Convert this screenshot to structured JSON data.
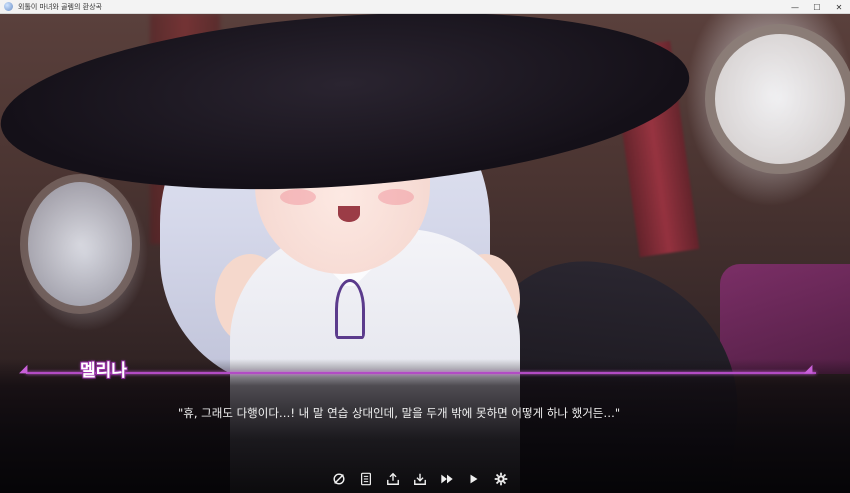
{
  "window": {
    "title": "외톨이 마녀와 골렘의 환상곡",
    "minimize_glyph": "—",
    "maximize_glyph": "☐",
    "close_glyph": "✕"
  },
  "dialogue": {
    "speaker": "멜리나",
    "text": "\"휴, 그래도 다행이다…! 내 말 연습 상대인데, 말을 두개 밖에 못하면 어떻게 하나 했거든…\"",
    "accent_color": "#b24cc4"
  },
  "controls": [
    {
      "name": "skip-unread-icon",
      "label": "skip"
    },
    {
      "name": "log-icon",
      "label": "log"
    },
    {
      "name": "save-icon",
      "label": "save"
    },
    {
      "name": "load-icon",
      "label": "load"
    },
    {
      "name": "fast-forward-icon",
      "label": "fast forward"
    },
    {
      "name": "auto-play-icon",
      "label": "auto"
    },
    {
      "name": "settings-gear-icon",
      "label": "settings"
    }
  ]
}
